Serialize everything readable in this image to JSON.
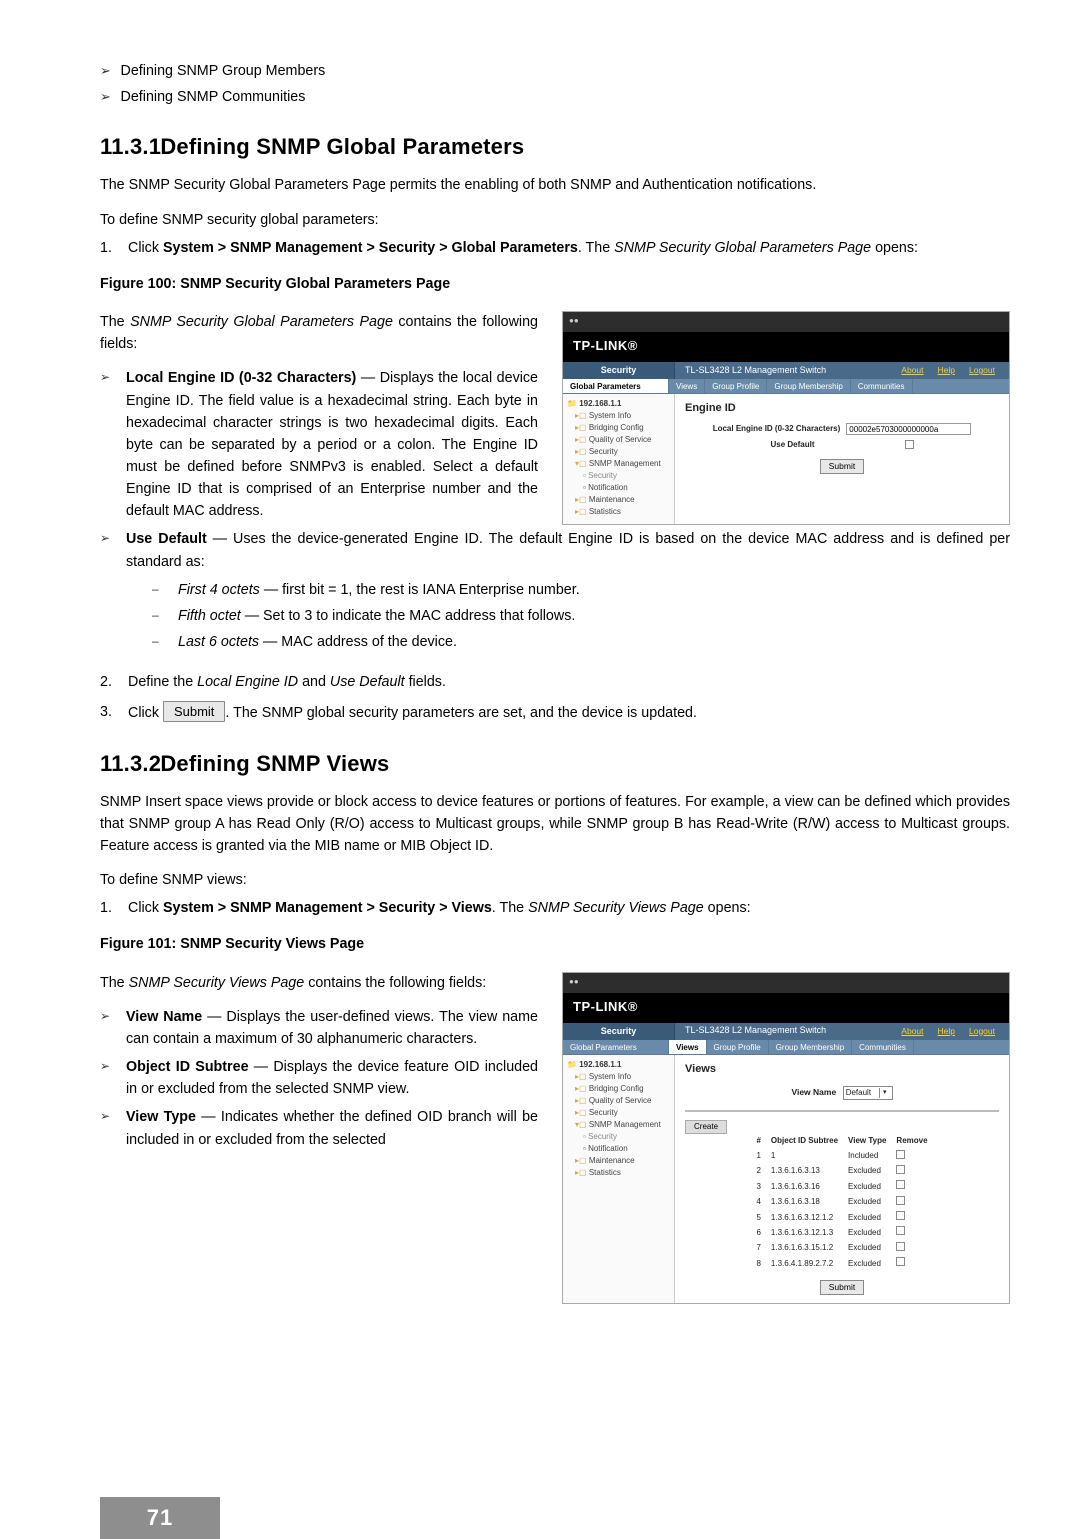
{
  "page_number": "71",
  "intro_bullets": [
    "Defining SNMP Group Members",
    "Defining SNMP Communities"
  ],
  "sec1": {
    "num": "11.3.1",
    "title": "Defining SNMP Global Parameters",
    "desc": "The SNMP Security Global Parameters Page permits the enabling of both SNMP and Authentication notifications.",
    "todef": "To define SNMP security global parameters:",
    "step1_a": "Click ",
    "step1_b": "System > SNMP Management > Security > Global Parameters",
    "step1_c": ". The ",
    "step1_it": "SNMP Security Global Parameters Page",
    "step1_d": " opens:",
    "fig": "Figure 100: SNMP Security Global Parameters Page",
    "contains_a": "The ",
    "contains_it": "SNMP Security Global Parameters Page",
    "contains_b": " contains the following fields:",
    "b1_bold": "Local Engine ID (0-32 Characters)",
    "b1_rest": " — Displays the local device Engine ID. The field value is a hexadecimal string. Each byte in hexadecimal character strings is two hexadecimal digits. Each byte can be separated by a period or a colon. The Engine ID must be defined before SNMPv3 is enabled. Select a default Engine ID that is comprised of an Enterprise number and the default MAC address.",
    "b2_bold": "Use Default",
    "b2_rest": " — Uses the device-generated Engine ID. The default Engine ID is based on the device MAC address and is defined per standard as:",
    "dash": {
      "d1_it": "First 4 octets",
      "d1": " — first bit = 1, the rest is IANA Enterprise number.",
      "d2_it": "Fifth octet",
      "d2": " — Set to 3 to indicate the MAC address that follows.",
      "d3_it": "Last 6 octets",
      "d3": " — MAC address of the device."
    },
    "step2_a": "Define the ",
    "step2_it1": "Local Engine ID",
    "step2_mid": " and ",
    "step2_it2": "Use Default",
    "step2_b": " fields.",
    "step3_a": "Click ",
    "step3_btn": "Submit",
    "step3_b": ". The SNMP global security parameters are set, and the device is updated."
  },
  "sec2": {
    "num": "11.3.2",
    "title": "Defining SNMP Views",
    "desc": "SNMP Insert space views provide or block access to device features or portions of features. For example, a view can be defined which provides that SNMP group A has Read Only (R/O) access to Multicast groups, while SNMP group B has Read-Write (R/W) access to Multicast groups. Feature access is granted via the MIB name or MIB Object ID.",
    "todef": "To define SNMP views:",
    "step1_a": "Click ",
    "step1_b": "System > SNMP Management > Security > Views",
    "step1_c": ". The ",
    "step1_it": "SNMP Security Views Page",
    "step1_d": " opens:",
    "fig": "Figure 101: SNMP Security Views Page",
    "contains_a": "The ",
    "contains_it": "SNMP Security Views Page",
    "contains_b": " contains the following fields:",
    "b1_bold": "View Name",
    "b1_rest": " — Displays the user-defined views. The view name can contain a maximum of 30 alphanumeric characters.",
    "b2_bold": "Object ID Subtree",
    "b2_rest": " — Displays the device feature OID included in or excluded from the selected SNMP view.",
    "b3_bold": "View Type",
    "b3_rest": " — Indicates whether the defined OID branch will be included in or excluded from the selected"
  },
  "shot": {
    "tp": "TP-LINK®",
    "switch_model": "TL-SL3428 L2 Management Switch",
    "security": "Security",
    "links": {
      "about": "About",
      "help": "Help",
      "logout": "Logout"
    },
    "tabs": [
      "Global Parameters",
      "Views",
      "Group Profile",
      "Group Membership",
      "Communities"
    ],
    "tree_root": "192.168.1.1",
    "tree_items": [
      "System Info",
      "Bridging Config",
      "Quality of Service",
      "Security",
      "SNMP Management",
      "Security",
      "Notification",
      "Maintenance",
      "Statistics"
    ],
    "engine_id": "Engine ID",
    "lbl_local": "Local Engine ID (0-32 Characters)",
    "val_local": "00002e5703000000000a",
    "lbl_use_default": "Use Default",
    "submit": "Submit",
    "views_heading": "Views",
    "view_name_lbl": "View Name",
    "view_name_val": "Default",
    "create": "Create",
    "tbl_headers": [
      "#",
      "Object ID Subtree",
      "View Type",
      "Remove"
    ],
    "tbl_rows": [
      {
        "n": "1",
        "oid": "1",
        "vt": "Included"
      },
      {
        "n": "2",
        "oid": "1.3.6.1.6.3.13",
        "vt": "Excluded"
      },
      {
        "n": "3",
        "oid": "1.3.6.1.6.3.16",
        "vt": "Excluded"
      },
      {
        "n": "4",
        "oid": "1.3.6.1.6.3.18",
        "vt": "Excluded"
      },
      {
        "n": "5",
        "oid": "1.3.6.1.6.3.12.1.2",
        "vt": "Excluded"
      },
      {
        "n": "6",
        "oid": "1.3.6.1.6.3.12.1.3",
        "vt": "Excluded"
      },
      {
        "n": "7",
        "oid": "1.3.6.1.6.3.15.1.2",
        "vt": "Excluded"
      },
      {
        "n": "8",
        "oid": "1.3.6.4.1.89.2.7.2",
        "vt": "Excluded"
      }
    ]
  }
}
